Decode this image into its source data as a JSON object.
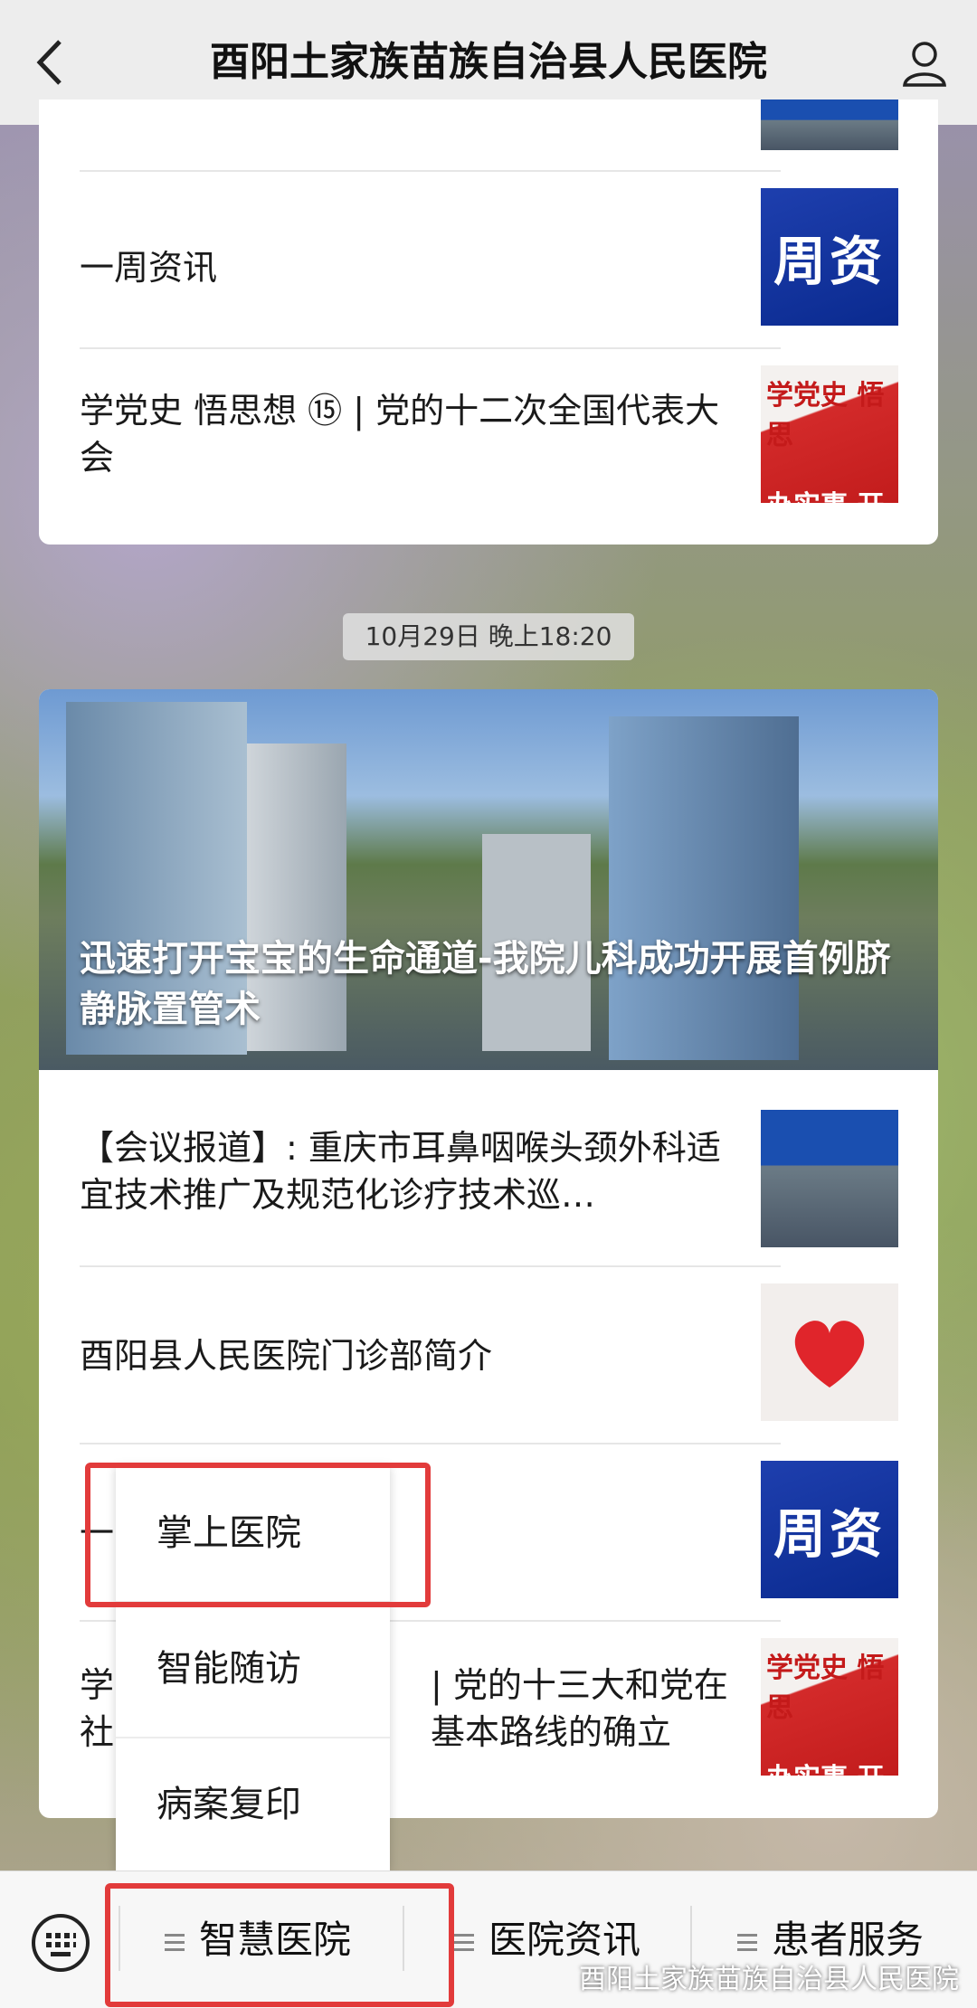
{
  "topbar": {
    "title": "酉阳土家族苗族自治县人民医院",
    "back_icon": "chevron-left-icon",
    "user_icon": "user-icon"
  },
  "card1": {
    "items": [
      {
        "title": "一周资讯",
        "thumb_text": "周资"
      },
      {
        "title": "学党史  悟思想 ⑮ | 党的十二次全国代表大会",
        "thumb_line1": "学党史 悟思",
        "thumb_line2": "办实事 开"
      }
    ]
  },
  "timestamp": "10月29日 晚上18:20",
  "card2": {
    "hero_title": "迅速打开宝宝的生命通道-我院儿科成功开展首例脐静脉置管术",
    "items": [
      {
        "title": "【会议报道】: 重庆市耳鼻咽喉头颈外科适宜技术推广及规范化诊疗技术巡…"
      },
      {
        "title": "酉阳县人民医院门诊部简介"
      },
      {
        "title": "一",
        "thumb_text": "周资"
      },
      {
        "title_line1": "学",
        "title_line1b": "| 党的十三大和党在",
        "title_line2": "社",
        "title_line2b": "基本路线的确立",
        "thumb_line1": "学党史 悟思",
        "thumb_line2": "办实事 开"
      }
    ]
  },
  "menu": {
    "items": [
      "掌上医院",
      "智能随访",
      "病案复印"
    ]
  },
  "bottombar": {
    "keyboard_icon": "keyboard-icon",
    "tabs": [
      "智慧医院",
      "医院资讯",
      "患者服务"
    ],
    "watermark": "酉阳土家族苗族自治县人民医院"
  },
  "colors": {
    "highlight": "#e23b3b",
    "topbar_bg": "#ededed"
  }
}
